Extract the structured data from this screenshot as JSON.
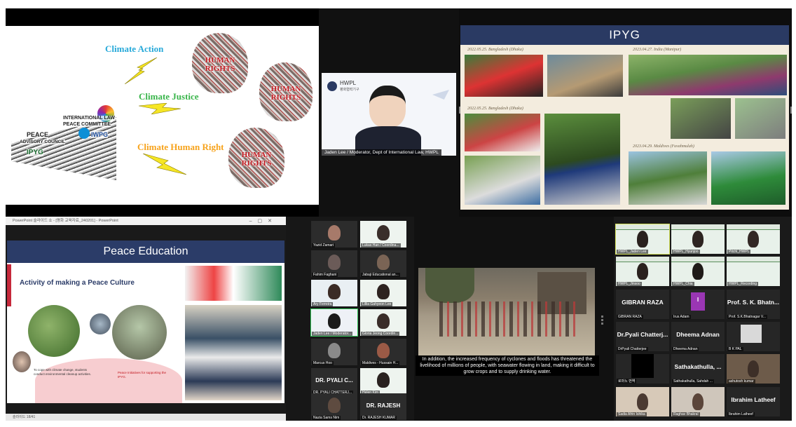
{
  "panel_climate": {
    "labels": [
      "Climate Action",
      "Climate Justice",
      "Climate Human Right"
    ],
    "human_rights": "HUMAN RIGHTS",
    "tags": [
      "INTERNATIONAL LAW",
      "PEACE COMMITTEE",
      "IWPG",
      "IPYG",
      "PEACE",
      "ADVISORY COUNCIL"
    ],
    "colors": {
      "action": "#27a9d9",
      "justice": "#39b54a",
      "right": "#f7a31c",
      "bolt": "#f6e625"
    }
  },
  "panel_moderator": {
    "logo": "HWPL",
    "logo_sub": "평화협력기구",
    "name_tag": "Jaden Lee / Moderator, Dept of International Law, HWPL"
  },
  "panel_ipyg": {
    "title": "IPYG",
    "captions": [
      "2022.05.25. Bangladesh (Dhaka)",
      "2023.04.27. India (Manipur)",
      "2022.05.25. Bangladesh (Dhaka)",
      "2023.04.29. Maldives (Fuvahmulah)"
    ]
  },
  "panel_peace": {
    "titlebar": "PowerPoint 슬라이드 쇼 - [평화 교육자료_240201] - PowerPoint",
    "title": "Peace Education",
    "heading": "Activity of making a Peace Culture",
    "left_caption": "To cope with climate change, students conduct environmental cleanup activities.",
    "right_caption": "Peace Initiatives for supporting the IPYG.",
    "statusbar": "슬라이드 18/41"
  },
  "gallery": {
    "tiles": [
      {
        "name": "Yazid Zamari",
        "big": ""
      },
      {
        "name": "Lukas Han / Coordina...",
        "big": ""
      },
      {
        "name": "Fahim Faghani",
        "big": ""
      },
      {
        "name": "Jabaji Educational an...",
        "big": ""
      },
      {
        "name": "Ary Ferreira",
        "big": ""
      },
      {
        "name": "Lillia Gahyeon Lee",
        "big": ""
      },
      {
        "name": "Jaden Lee / Moderator...",
        "big": ""
      },
      {
        "name": "Gloria Jeong Coordin...",
        "big": ""
      },
      {
        "name": "Marcus Hoo",
        "big": ""
      },
      {
        "name": "Maldives - Hussain H...",
        "big": ""
      },
      {
        "name": "DR. PYALI CHATTERJ...",
        "big": "DR. PYALI C..."
      },
      {
        "name": "Helen Kim",
        "big": ""
      },
      {
        "name": "Nazia Sams Nim",
        "big": ""
      },
      {
        "name": "Dr. RAJESH KUMAR",
        "big": "DR. RAJESH"
      }
    ]
  },
  "flood": {
    "caption": "In addition, the increased frequency of cyclones and floods has threatened the livelihood of millions of people, with seawater flowing in land, making it difficult to grow crops and to supply drinking water."
  },
  "grid": {
    "tiles": [
      {
        "name": "HWPL_Jaden Lee",
        "big": ""
      },
      {
        "name": "HWPL_Hyunjoo",
        "big": ""
      },
      {
        "name": "Pitchl_HWPL",
        "big": ""
      },
      {
        "name": "HWPL_Jinsoo",
        "big": ""
      },
      {
        "name": "HWPL_Chia",
        "big": ""
      },
      {
        "name": "HWPL_Recording",
        "big": ""
      },
      {
        "name": "GIBRAN RAZA",
        "big": "GIBRAN RAZA"
      },
      {
        "name": "Irus Adam",
        "big": "I"
      },
      {
        "name": "Prof. S.K.Bhatnagar V...",
        "big": "Prof. S. K. Bhatn..."
      },
      {
        "name": "DrPyali Chatterjee",
        "big": "Dr.Pyali Chatterj..."
      },
      {
        "name": "Dheema Adnan",
        "big": "Dheema Adnan"
      },
      {
        "name": "B K PAL",
        "big": ""
      },
      {
        "name": "로마노 번역",
        "big": ""
      },
      {
        "name": "Sathakathulla, Sahdah ...",
        "big": "Sathakathulla, ..."
      },
      {
        "name": "ashutosh kumar",
        "big": ""
      },
      {
        "name": "Sadia Afrin Ishika",
        "big": ""
      },
      {
        "name": "Raghav Bhakral",
        "big": ""
      },
      {
        "name": "Ibrahim Latheef",
        "big": "Ibrahim Latheef"
      }
    ]
  }
}
